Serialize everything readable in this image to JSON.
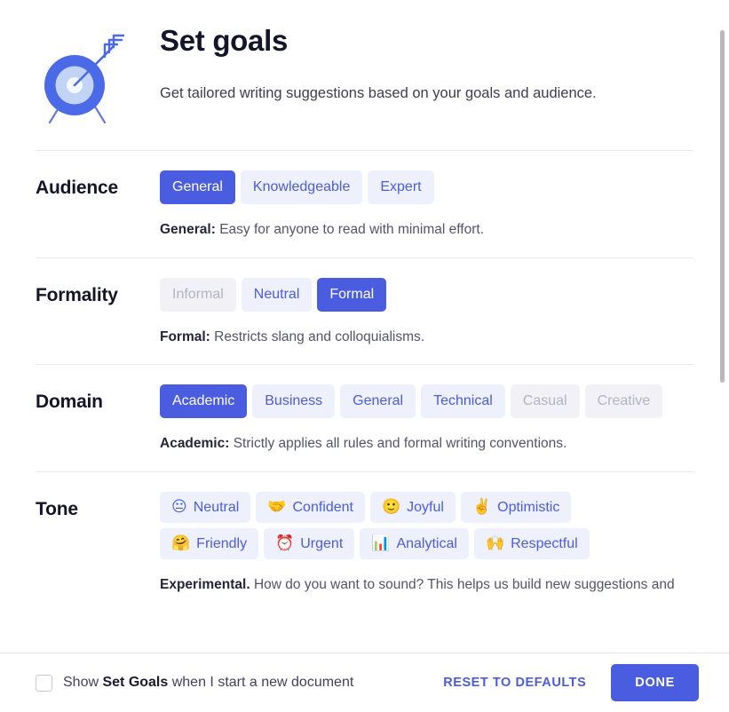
{
  "header": {
    "icon_name": "target-goal-icon",
    "title": "Set goals",
    "subtitle": "Get tailored writing suggestions based on your goals and audience."
  },
  "sections": {
    "audience": {
      "label": "Audience",
      "options": [
        {
          "label": "General",
          "state": "selected"
        },
        {
          "label": "Knowledgeable",
          "state": "default"
        },
        {
          "label": "Expert",
          "state": "default"
        }
      ],
      "description_label": "General:",
      "description_text": " Easy for anyone to read with minimal effort."
    },
    "formality": {
      "label": "Formality",
      "options": [
        {
          "label": "Informal",
          "state": "disabled"
        },
        {
          "label": "Neutral",
          "state": "default"
        },
        {
          "label": "Formal",
          "state": "selected"
        }
      ],
      "description_label": "Formal:",
      "description_text": " Restricts slang and colloquialisms."
    },
    "domain": {
      "label": "Domain",
      "options": [
        {
          "label": "Academic",
          "state": "selected"
        },
        {
          "label": "Business",
          "state": "default"
        },
        {
          "label": "General",
          "state": "default"
        },
        {
          "label": "Technical",
          "state": "default"
        },
        {
          "label": "Casual",
          "state": "disabled"
        },
        {
          "label": "Creative",
          "state": "disabled"
        }
      ],
      "description_label": "Academic:",
      "description_text": " Strictly applies all rules and formal writing conventions."
    },
    "tone": {
      "label": "Tone",
      "row1": [
        {
          "label": "Neutral",
          "emoji": "😐",
          "icon_name": "neutral-face-emoji"
        },
        {
          "label": "Confident",
          "emoji": "🤝",
          "icon_name": "handshake-emoji"
        },
        {
          "label": "Joyful",
          "emoji": "🙂",
          "icon_name": "slightly-smiling-face-emoji"
        },
        {
          "label": "Optimistic",
          "emoji": "✌️",
          "icon_name": "victory-hand-emoji"
        }
      ],
      "row2": [
        {
          "label": "Friendly",
          "emoji": "🤗",
          "icon_name": "hugging-face-emoji"
        },
        {
          "label": "Urgent",
          "emoji": "⏰",
          "icon_name": "alarm-clock-emoji"
        },
        {
          "label": "Analytical",
          "emoji": "📊",
          "icon_name": "bar-chart-emoji"
        },
        {
          "label": "Respectful",
          "emoji": "🙌",
          "icon_name": "raising-hands-emoji"
        }
      ],
      "description_label": "Experimental.",
      "description_text": " How do you want to sound? This helps us build new suggestions and"
    }
  },
  "footer": {
    "checkbox_checked": false,
    "checkbox_text_before": "Show ",
    "checkbox_text_bold": "Set Goals",
    "checkbox_text_after": " when I start a new document",
    "reset_label": "RESET TO DEFAULTS",
    "done_label": "DONE"
  },
  "colors": {
    "accent": "#4a5ce0",
    "chip_bg": "#eef0fc",
    "chip_text": "#4a5ce0",
    "disabled_text": "#b2b3c4",
    "divider": "#e8e8ef",
    "scrollbar_thumb": "#b9b9bd"
  }
}
